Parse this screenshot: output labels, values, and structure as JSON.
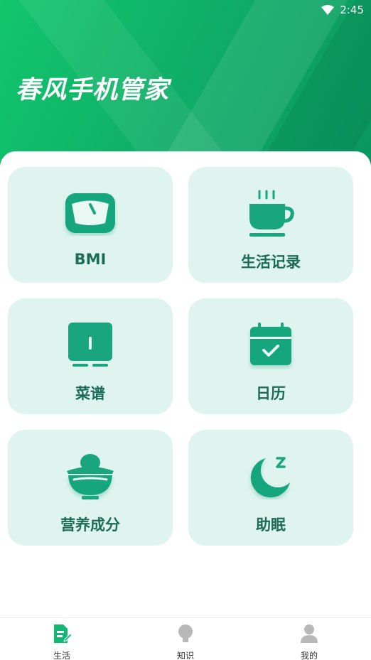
{
  "status_bar": {
    "time": "2:45"
  },
  "app": {
    "title": "春风手机管家"
  },
  "cards": [
    {
      "label": "BMI",
      "icon": "scale-icon"
    },
    {
      "label": "生活记录",
      "icon": "coffee-cup-icon"
    },
    {
      "label": "菜谱",
      "icon": "open-book-icon"
    },
    {
      "label": "日历",
      "icon": "calendar-check-icon"
    },
    {
      "label": "营养成分",
      "icon": "food-bowl-icon"
    },
    {
      "label": "助眠",
      "icon": "moon-sleep-icon"
    }
  ],
  "tabs": [
    {
      "label": "生活",
      "icon": "document-edit-icon",
      "active": true
    },
    {
      "label": "知识",
      "icon": "lightbulb-icon",
      "active": false
    },
    {
      "label": "我的",
      "icon": "user-icon",
      "active": false
    }
  ],
  "colors": {
    "brand_green": "#10b46c",
    "card_bg": "#dff4ef",
    "icon_green": "#19a67e",
    "label_text": "#1c6b57",
    "inactive_icon": "#b8b8b8"
  }
}
